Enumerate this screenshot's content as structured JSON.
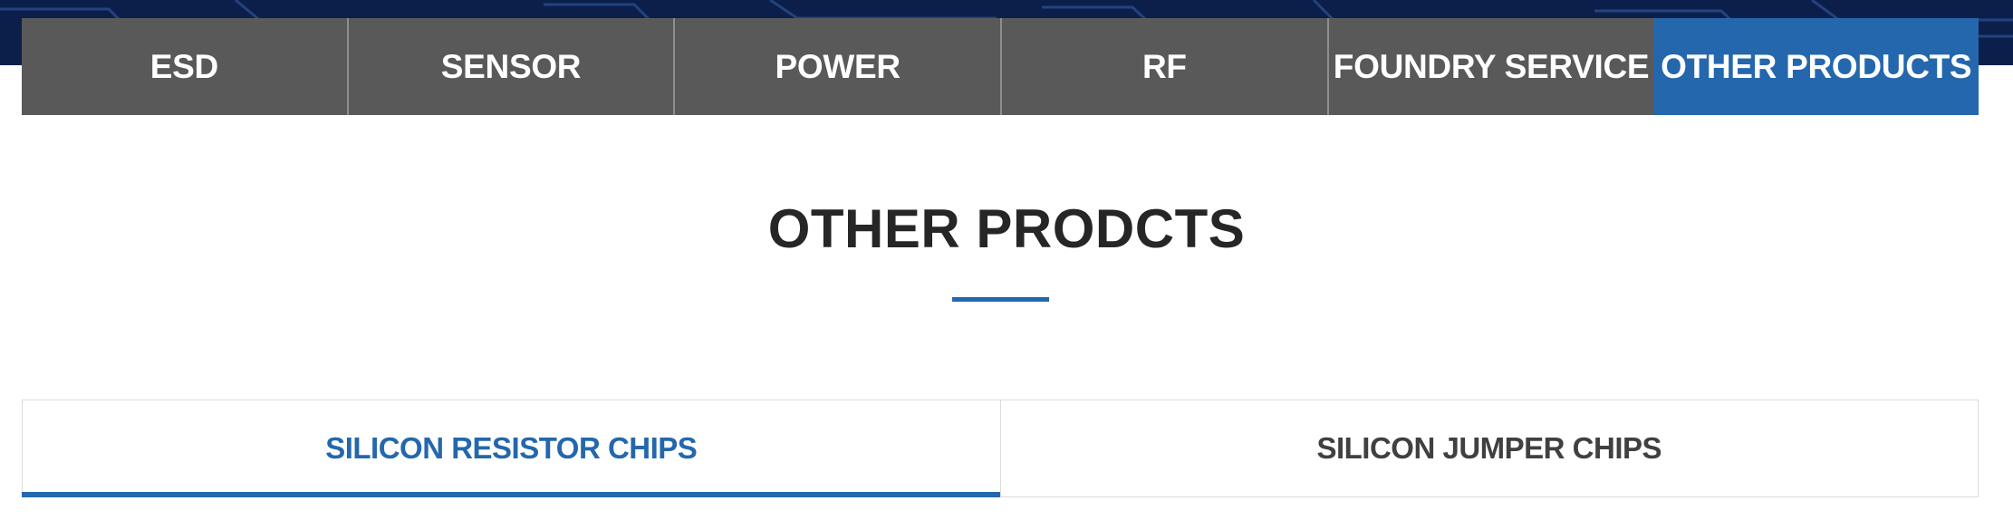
{
  "colors": {
    "accent": "#2467ad",
    "tab_bg": "#595959",
    "hero_bg": "#0c1f4a"
  },
  "top_nav": {
    "tabs": [
      {
        "label": "ESD",
        "active": false
      },
      {
        "label": "SENSOR",
        "active": false
      },
      {
        "label": "POWER",
        "active": false
      },
      {
        "label": "RF",
        "active": false
      },
      {
        "label": "FOUNDRY SERVICE",
        "active": false
      },
      {
        "label": "OTHER PRODUCTS",
        "active": true
      }
    ]
  },
  "main": {
    "title": "OTHER PRODCTS"
  },
  "sub_nav": {
    "tabs": [
      {
        "label": "SILICON RESISTOR CHIPS",
        "active": true
      },
      {
        "label": "SILICON JUMPER CHIPS",
        "active": false
      }
    ]
  }
}
